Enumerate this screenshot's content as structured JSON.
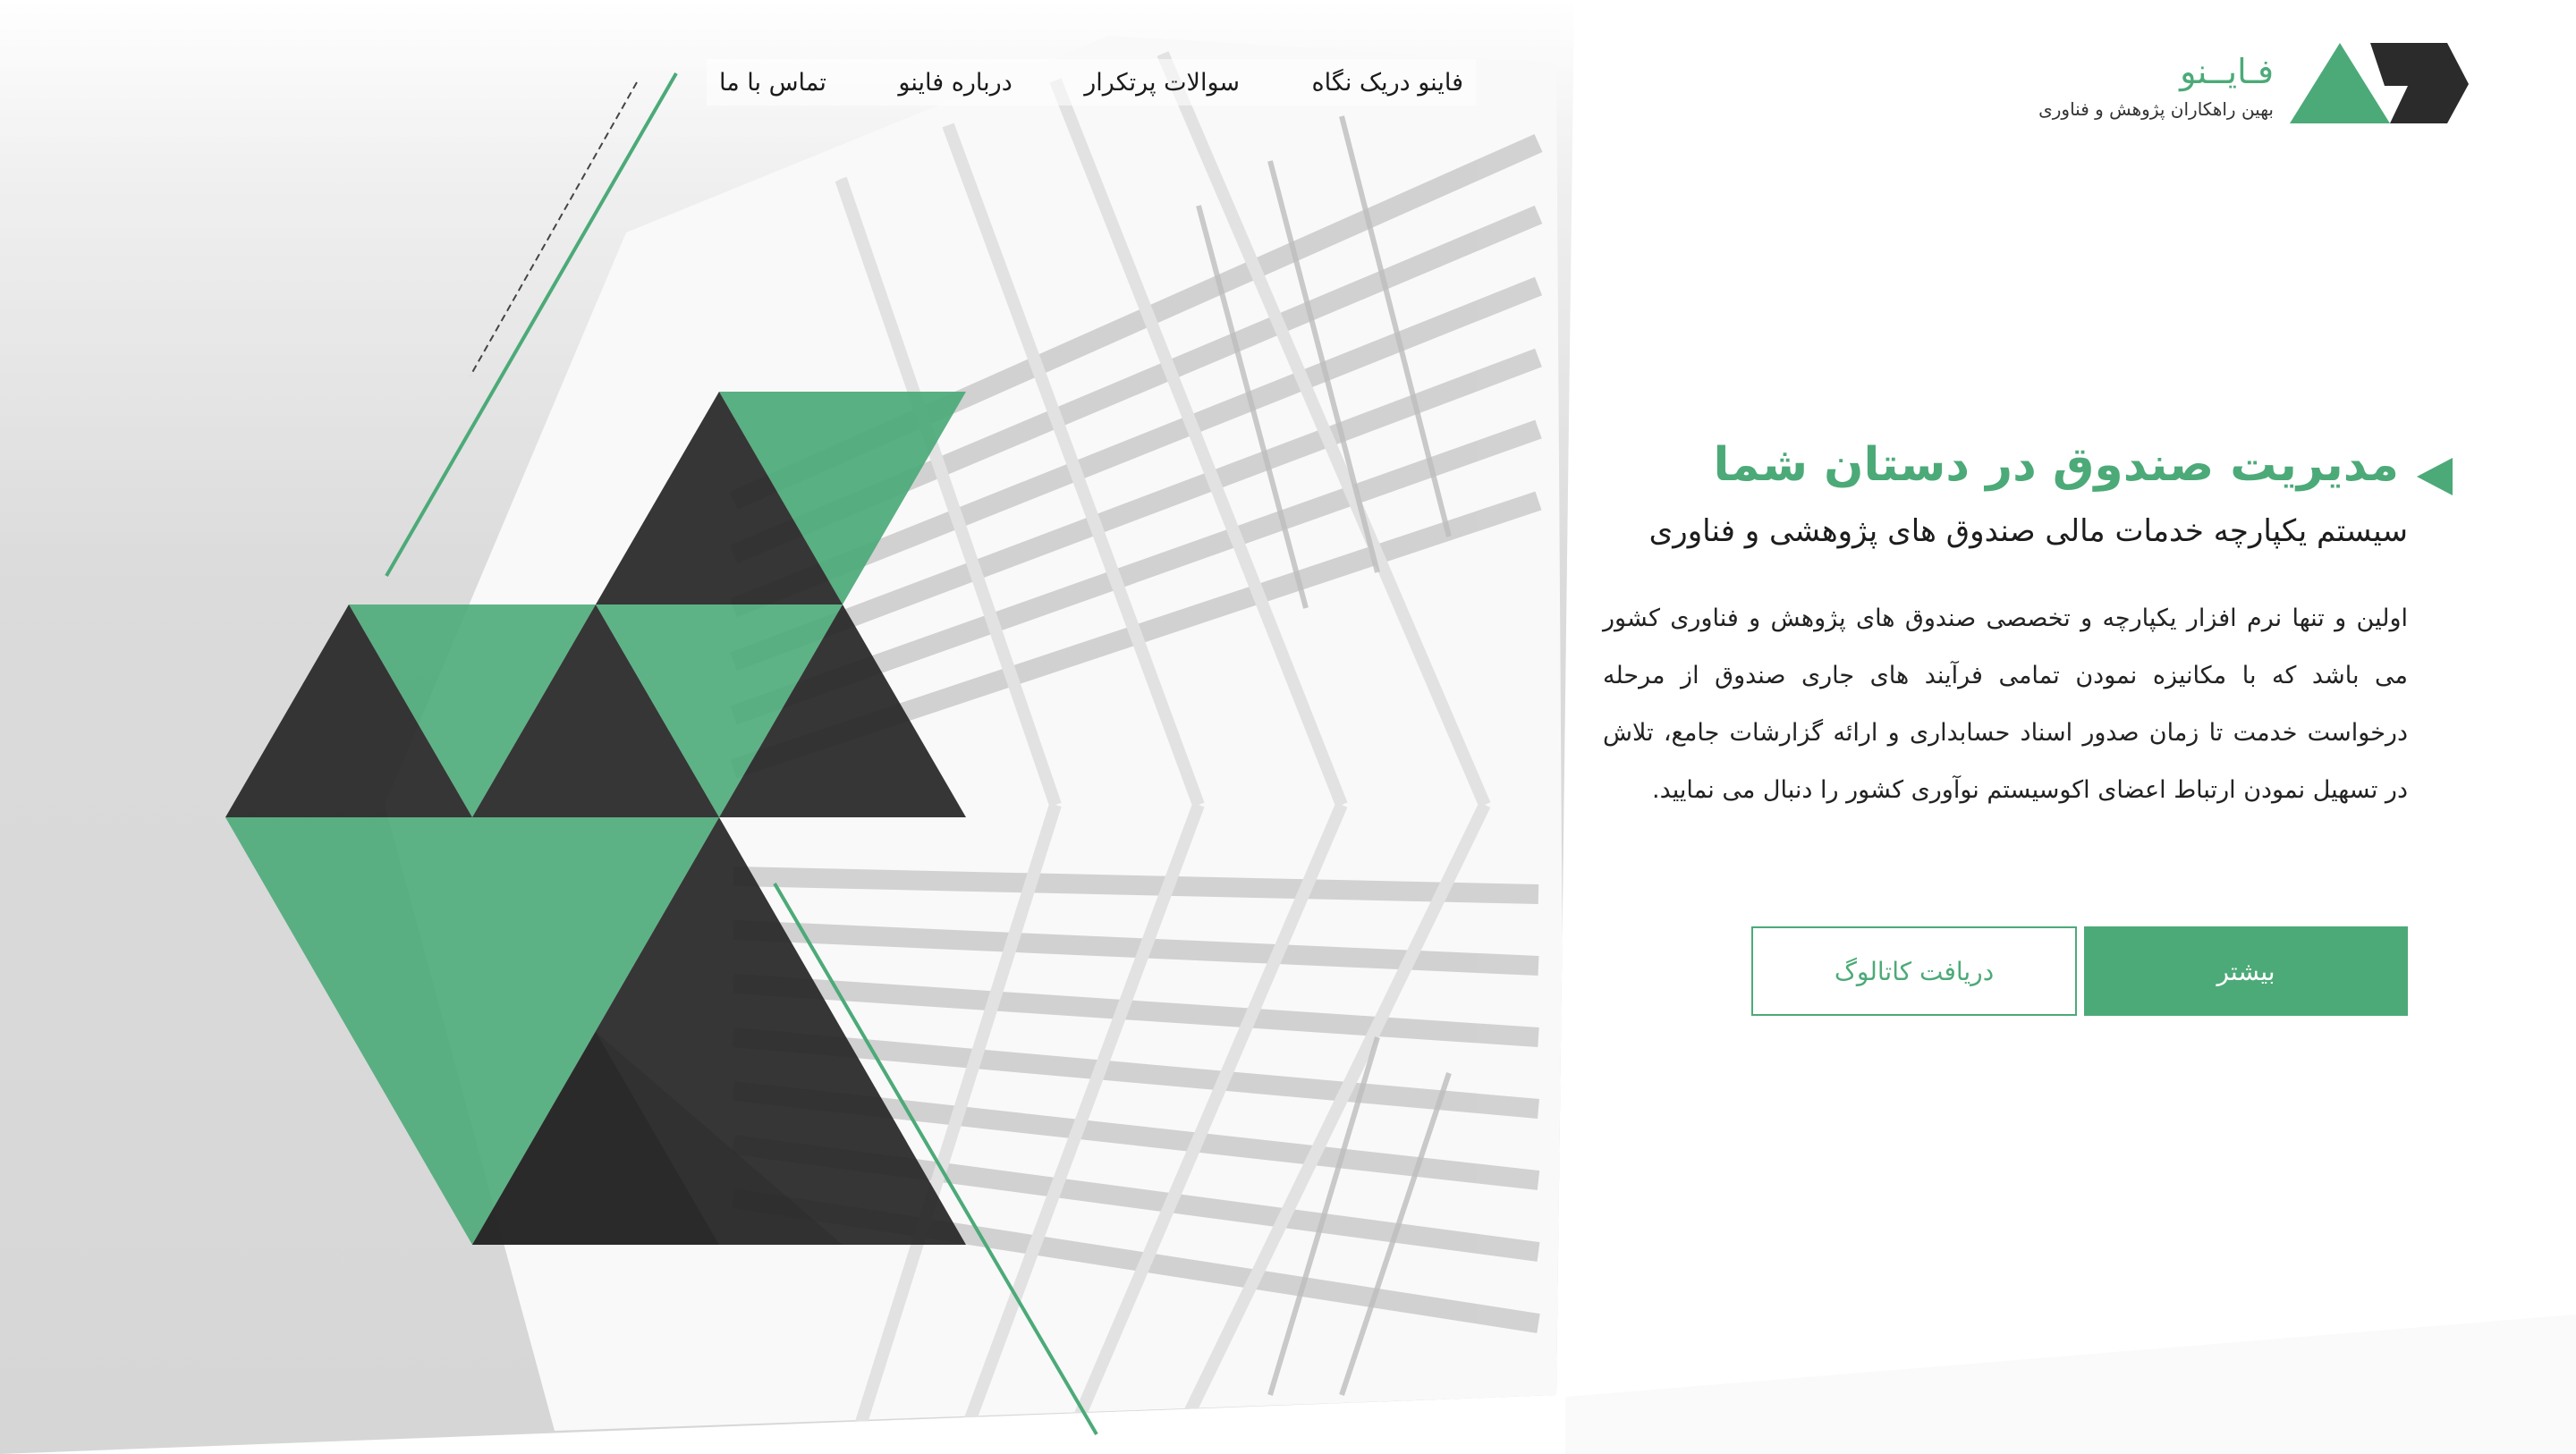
{
  "brand": {
    "name": "فـایــنو",
    "tagline": "بهین راهکاران پژوهش و فناوری",
    "accent_color": "#4caa78",
    "dark_color": "#2b2b2b"
  },
  "nav": {
    "items": [
      {
        "label": "فاینو دریک نگاه"
      },
      {
        "label": "سوالات پرتکرار"
      },
      {
        "label": "درباره فاینو"
      },
      {
        "label": "تماس با ما"
      }
    ]
  },
  "hero": {
    "title": "مدیریت صندوق در دستان شما",
    "subtitle": "سیستم یکپارچه خدمات مالی صندوق های پژوهشی و فناوری",
    "body": "اولین و تنها نرم افزار یکپارچه و تخصصی صندوق های پژوهش و فناوری کشور می باشد که با مکانیزه نمودن تمامی فرآیند های جاری صندوق از مرحله درخواست خدمت تا زمان صدور اسناد حسابداری و ارائه گزارشات جامع، تلاش در تسهیل نمودن ارتباط اعضای اکوسیستم نوآوری کشور را دنبال می نمایید."
  },
  "buttons": {
    "more_label": "بیشتر",
    "catalog_label": "دریافت کاتالوگ"
  }
}
